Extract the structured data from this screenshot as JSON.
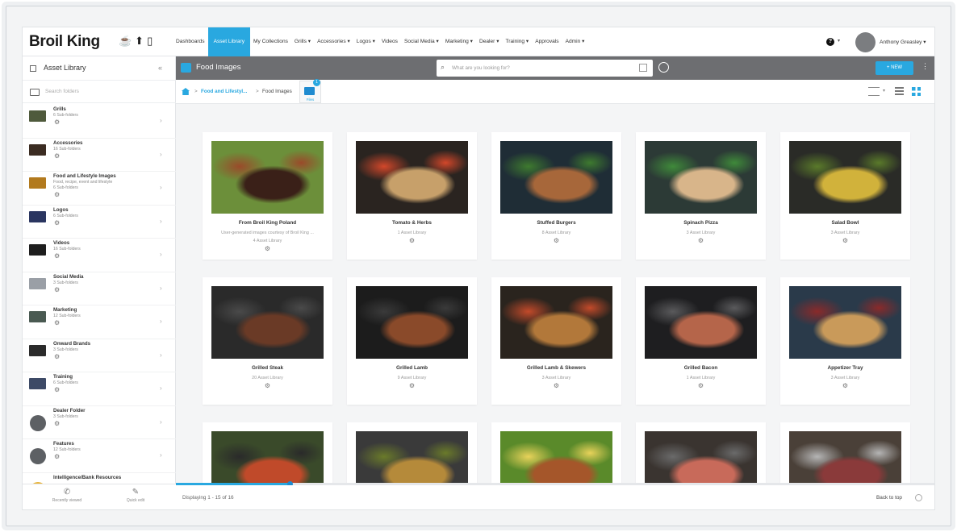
{
  "brand": {
    "logo_text": "Broil King",
    "logo_icons": "☕⬆▯"
  },
  "nav": {
    "items": [
      {
        "label": "Dashboards",
        "active": false
      },
      {
        "label": "Asset Library",
        "active": true
      },
      {
        "label": "My Collections",
        "active": false
      },
      {
        "label": "Grills ▾",
        "active": false
      },
      {
        "label": "Accessories ▾",
        "active": false
      },
      {
        "label": "Logos ▾",
        "active": false
      },
      {
        "label": "Videos",
        "active": false
      },
      {
        "label": "Social Media ▾",
        "active": false
      },
      {
        "label": "Marketing ▾",
        "active": false
      },
      {
        "label": "Dealer ▾",
        "active": false
      },
      {
        "label": "Training ▾",
        "active": false
      },
      {
        "label": "Approvals",
        "active": false
      },
      {
        "label": "Admin ▾",
        "active": false
      }
    ],
    "help_glyph": "?",
    "caret": "▾",
    "user_name": "Anthony Greasley ▾"
  },
  "sidebar": {
    "title": "Asset Library",
    "collapse_glyph": "«",
    "search_placeholder": "Search folders",
    "items": [
      {
        "name": "Grills",
        "desc": "",
        "sub": "6 Sub-folders",
        "thumb": "#4f5a3c",
        "round": false
      },
      {
        "name": "Accessories",
        "desc": "",
        "sub": "16 Sub-folders",
        "thumb": "#3b2c22",
        "round": false
      },
      {
        "name": "Food and Lifestyle Images",
        "desc": "Food, recipe, event and lifestyle",
        "sub": "6 Sub-folders",
        "thumb": "#b27a1e",
        "round": false
      },
      {
        "name": "Logos",
        "desc": "",
        "sub": "6 Sub-folders",
        "thumb": "#2a3560",
        "round": false
      },
      {
        "name": "Videos",
        "desc": "",
        "sub": "16 Sub-folders",
        "thumb": "#1e1e1e",
        "round": false
      },
      {
        "name": "Social Media",
        "desc": "",
        "sub": "3 Sub-folders",
        "thumb": "#9a9fa6",
        "round": false
      },
      {
        "name": "Marketing",
        "desc": "",
        "sub": "12 Sub-folders",
        "thumb": "#4a5a52",
        "round": false
      },
      {
        "name": "Onward Brands",
        "desc": "",
        "sub": "3 Sub-folders",
        "thumb": "#2b2b2b",
        "round": false
      },
      {
        "name": "Training",
        "desc": "",
        "sub": "6 Sub-folders",
        "thumb": "#3d4a66",
        "round": false
      },
      {
        "name": "Dealer Folder",
        "desc": "",
        "sub": "3 Sub-folders",
        "thumb": "#5d6064",
        "round": true
      },
      {
        "name": "Features",
        "desc": "",
        "sub": "12 Sub-folders",
        "thumb": "#5d6064",
        "round": true
      },
      {
        "name": "Intelligence/Bank Resources",
        "desc": "",
        "sub": "",
        "thumb": "#e8b43a",
        "round": true
      }
    ],
    "footer": {
      "left_label": "Recently viewed",
      "left_icon": "✆",
      "right_label": "Quick edit",
      "right_icon": "✎"
    }
  },
  "toolbar": {
    "title": "Food Images",
    "search_placeholder": "What are you looking for?",
    "new_label": "+ NEW",
    "more_glyph": "⋮",
    "search_glyph": "⌕"
  },
  "breadcrumb": {
    "parent": "Food and Lifestyl...",
    "sep": ">",
    "current": "Food Images",
    "folder_badge": "1",
    "folder_label": "Files"
  },
  "cards": [
    {
      "name": "From Broil King Poland",
      "desc": "User-generated images courtesy of Broil King ...",
      "sub": "4 Asset Library",
      "img": [
        "#6c8f3a",
        "#3a2018",
        "#9a4a2a"
      ]
    },
    {
      "name": "Tomato & Herbs",
      "desc": "",
      "sub": "1 Asset Library",
      "img": [
        "#2a2420",
        "#c7a06a",
        "#d2472a"
      ]
    },
    {
      "name": "Stuffed Burgers",
      "desc": "",
      "sub": "8 Asset Library",
      "img": [
        "#1f2d36",
        "#a7673a",
        "#3e7a2f"
      ]
    },
    {
      "name": "Spinach Pizza",
      "desc": "",
      "sub": "3 Asset Library",
      "img": [
        "#2c3a36",
        "#d8b58a",
        "#3f8a3a"
      ]
    },
    {
      "name": "Salad Bowl",
      "desc": "",
      "sub": "3 Asset Library",
      "img": [
        "#2a2b27",
        "#d1b23b",
        "#5a7a2a"
      ]
    },
    {
      "name": "Grilled Steak",
      "desc": "",
      "sub": "20 Asset Library",
      "img": [
        "#2a2a2a",
        "#6a3a26",
        "#4a4a4a"
      ]
    },
    {
      "name": "Grilled Lamb",
      "desc": "",
      "sub": "9 Asset Library",
      "img": [
        "#1c1c1c",
        "#8a4a2a",
        "#3a3a3a"
      ]
    },
    {
      "name": "Grilled Lamb & Skewers",
      "desc": "",
      "sub": "3 Asset Library",
      "img": [
        "#2a241e",
        "#b2783a",
        "#c24a2a"
      ]
    },
    {
      "name": "Grilled Bacon",
      "desc": "",
      "sub": "1 Asset Library",
      "img": [
        "#1e1e20",
        "#b5654a",
        "#5a5a5c"
      ]
    },
    {
      "name": "Appetizer Tray",
      "desc": "",
      "sub": "3 Asset Library",
      "img": [
        "#2a3a4a",
        "#c99a5a",
        "#8a2a2a"
      ]
    },
    {
      "name": "",
      "desc": "",
      "sub": "",
      "img": [
        "#3a4a2a",
        "#c04a2a",
        "#2a2a2a"
      ]
    },
    {
      "name": "",
      "desc": "",
      "sub": "",
      "img": [
        "#3a3a3a",
        "#b58a3a",
        "#6a7a2a"
      ]
    },
    {
      "name": "",
      "desc": "",
      "sub": "",
      "img": [
        "#5a8a2a",
        "#a5562a",
        "#e8d25a"
      ]
    },
    {
      "name": "",
      "desc": "",
      "sub": "",
      "img": [
        "#3a3430",
        "#c86a5a",
        "#6a6a6a"
      ]
    },
    {
      "name": "",
      "desc": "",
      "sub": "",
      "img": [
        "#4a4038",
        "#8a3a3a",
        "#b5b5b5"
      ]
    }
  ],
  "footer": {
    "displaying": "Displaying 1 - 15 of 16",
    "back_to_top": "Back to top",
    "progress": 0.15
  },
  "colors": {
    "accent": "#29a8e0",
    "toolbar": "#6d6e71"
  }
}
